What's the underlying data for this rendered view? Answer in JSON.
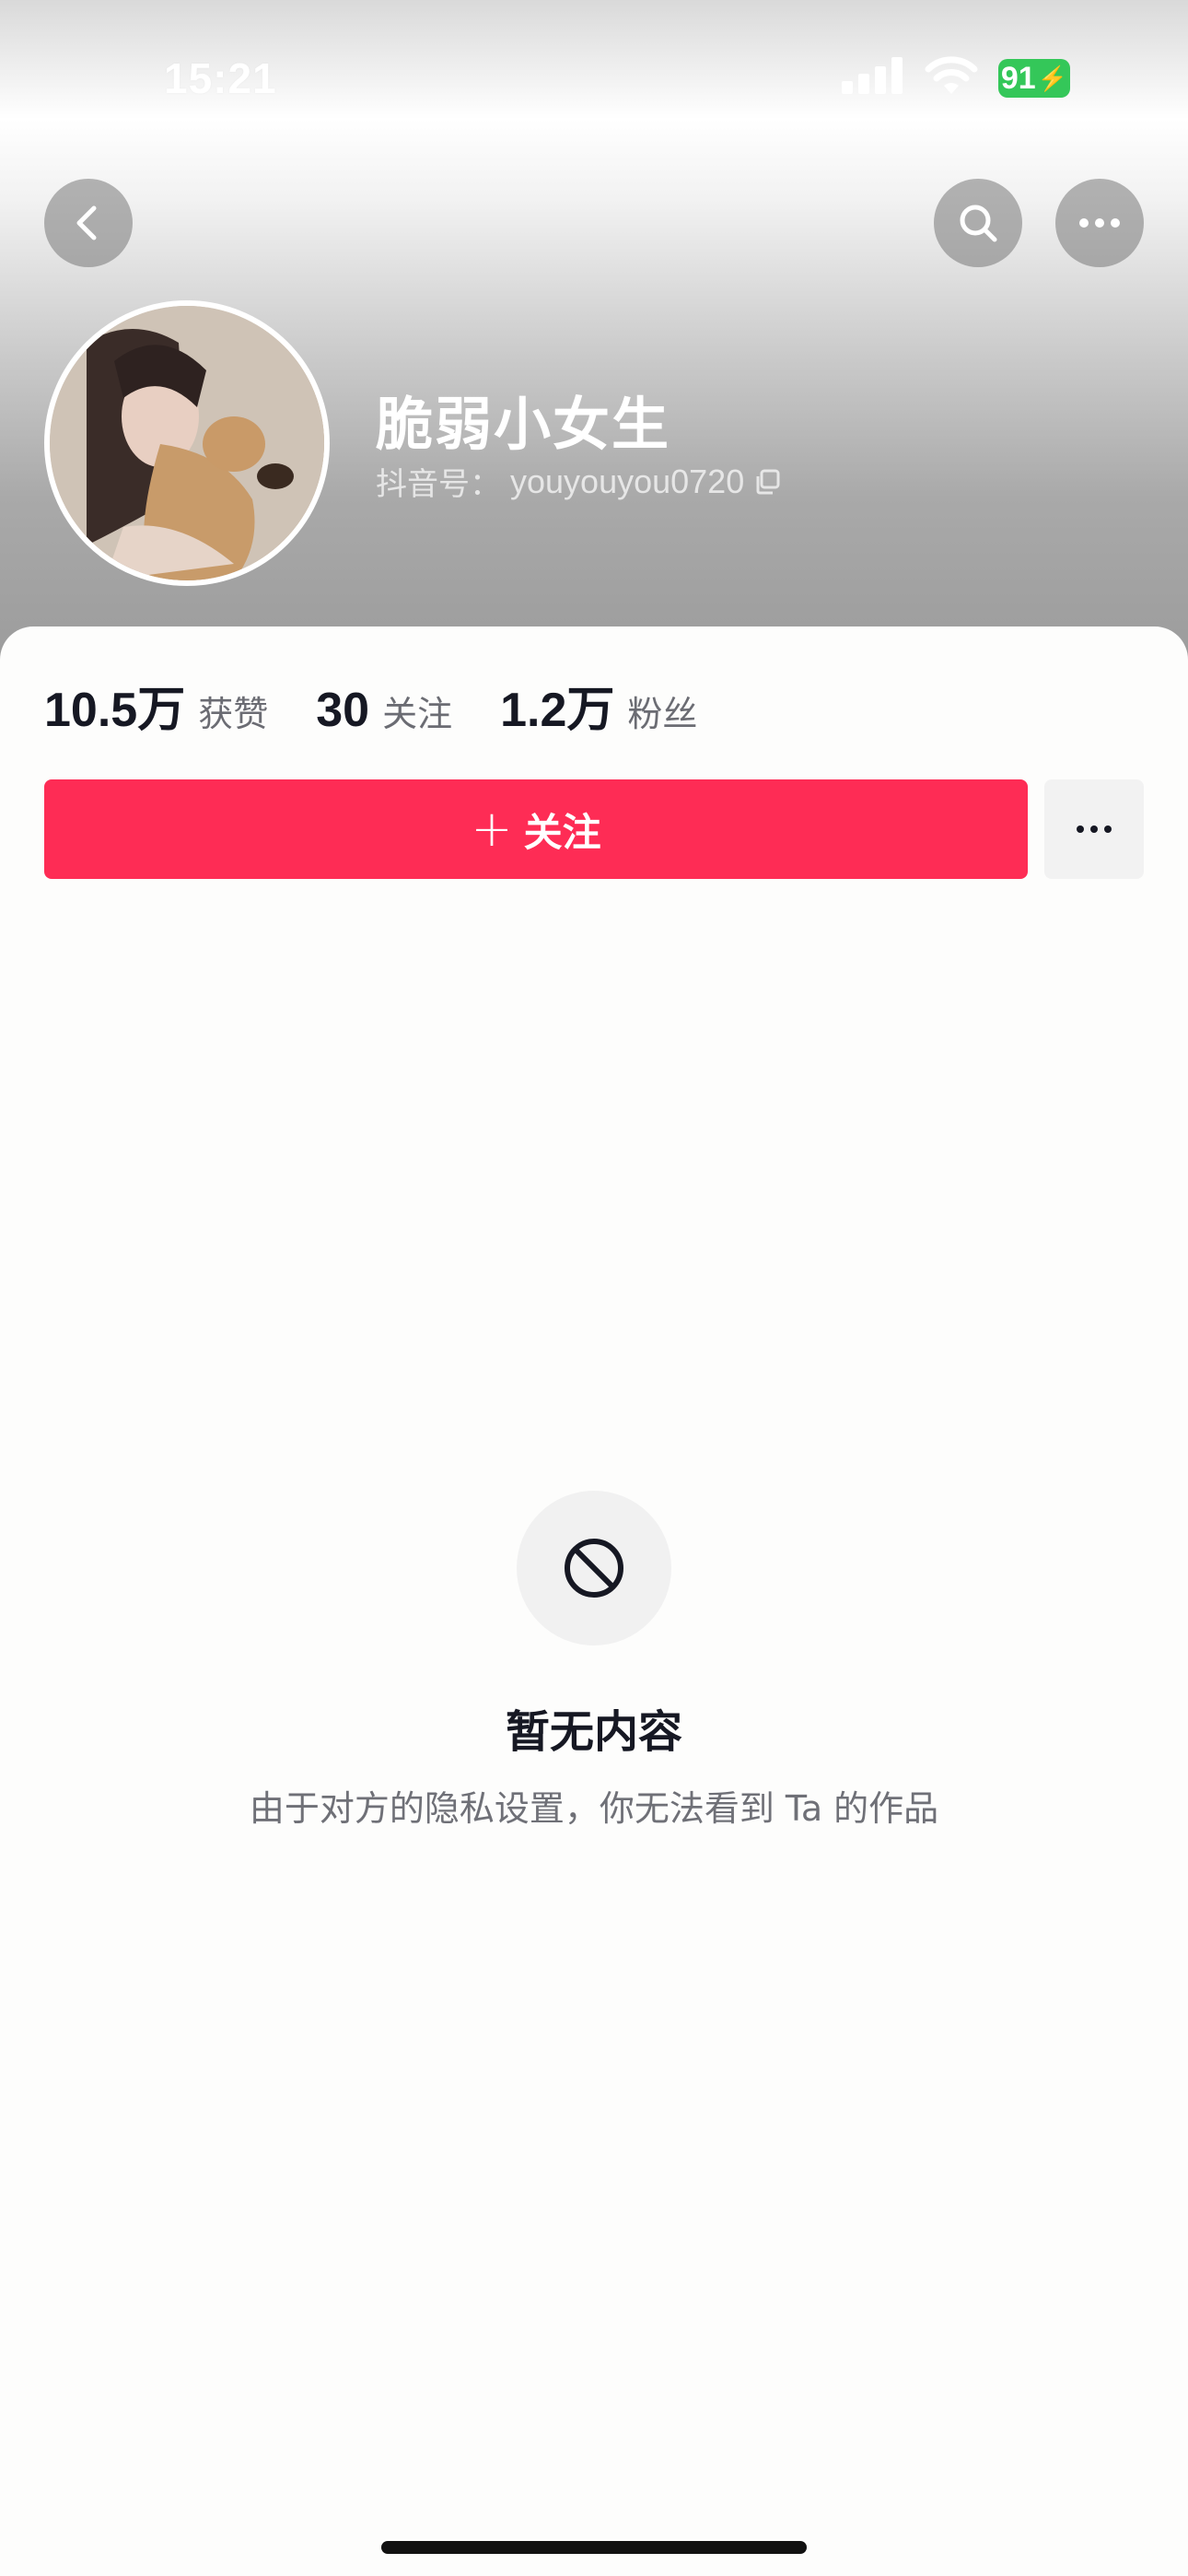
{
  "status_bar": {
    "time": "15:21",
    "battery": "91"
  },
  "header": {
    "username": "脆弱小女生",
    "douyin_id_label": "抖音号：",
    "douyin_id": "youyouyou0720"
  },
  "stats": [
    {
      "value": "10.5万",
      "label": "获赞"
    },
    {
      "value": "30",
      "label": "关注"
    },
    {
      "value": "1.2万",
      "label": "粉丝"
    }
  ],
  "follow_button": {
    "plus": "+",
    "label": "关注"
  },
  "empty_state": {
    "title": "暂无内容",
    "description": "由于对方的隐私设置，你无法看到 Ta 的作品"
  },
  "colors": {
    "accent": "#fe2c55",
    "battery": "#34c759",
    "text_primary": "#161823",
    "text_secondary": "#6b6c73"
  },
  "icons": [
    "back-icon",
    "search-icon",
    "more-icon",
    "copy-icon",
    "prohibited-icon",
    "signal-icon",
    "wifi-icon",
    "battery-icon"
  ]
}
